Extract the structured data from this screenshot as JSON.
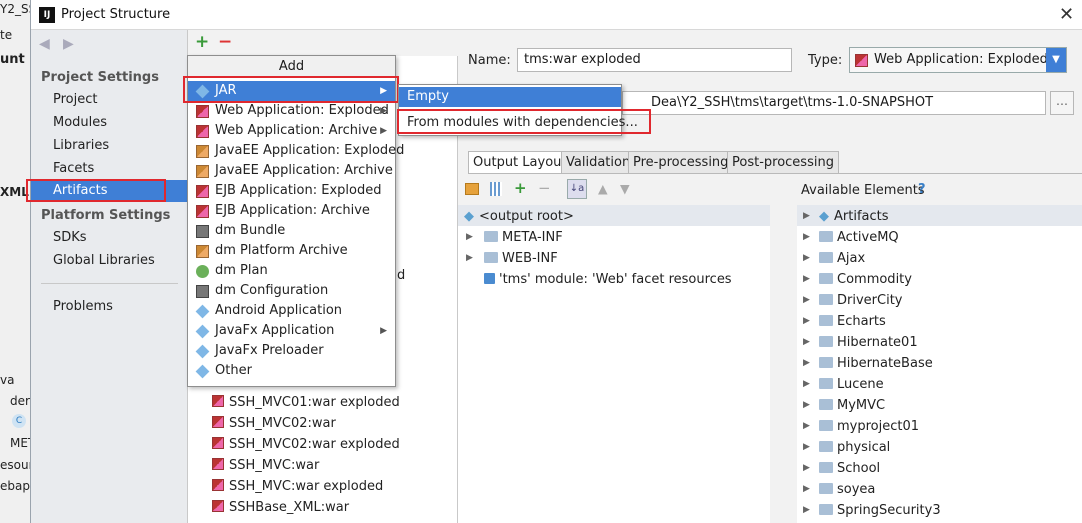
{
  "background_window": {
    "lines": [
      "Y2_SSH",
      "te",
      "C",
      "unt",
      "XML",
      "va",
      "der",
      "C",
      "MET",
      "esour",
      "ebap"
    ]
  },
  "window": {
    "title": "Project Structure",
    "close_glyph": "✕"
  },
  "left_nav": {
    "back": "◀",
    "forward": "▶",
    "project_settings_header": "Project Settings",
    "project_settings": [
      "Project",
      "Modules",
      "Libraries",
      "Facets",
      "Artifacts"
    ],
    "platform_settings_header": "Platform Settings",
    "platform_settings": [
      "SDKs",
      "Global Libraries"
    ],
    "problems": "Problems"
  },
  "artifacts_toolbar": {
    "add": "+",
    "remove": "−"
  },
  "artifacts_list": [
    {
      "name": "d",
      "partial": true
    },
    {
      "name": "SSH_MVC01:war exploded"
    },
    {
      "name": "SSH_MVC02:war"
    },
    {
      "name": "SSH_MVC02:war exploded"
    },
    {
      "name": "SSH_MVC:war"
    },
    {
      "name": "SSH_MVC:war exploded"
    },
    {
      "name": "SSHBase_XML:war"
    }
  ],
  "add_menu": {
    "header": "Add",
    "items": [
      {
        "label": "JAR",
        "icon": "jar-icon",
        "submenu": true,
        "highlighted": true
      },
      {
        "label": "Web Application: Exploded",
        "icon": "web-app-icon",
        "submenu": true
      },
      {
        "label": "Web Application: Archive",
        "icon": "web-app-icon",
        "submenu": true
      },
      {
        "label": "JavaEE Application: Exploded",
        "icon": "javaee-icon"
      },
      {
        "label": "JavaEE Application: Archive",
        "icon": "javaee-icon"
      },
      {
        "label": "EJB Application: Exploded",
        "icon": "ejb-icon"
      },
      {
        "label": "EJB Application: Archive",
        "icon": "ejb-icon"
      },
      {
        "label": "dm Bundle",
        "icon": "dm-bundle-icon"
      },
      {
        "label": "dm Platform Archive",
        "icon": "dm-platform-icon"
      },
      {
        "label": "dm Plan",
        "icon": "dm-plan-icon"
      },
      {
        "label": "dm Configuration",
        "icon": "dm-config-icon"
      },
      {
        "label": "Android Application",
        "icon": "android-icon"
      },
      {
        "label": "JavaFx Application",
        "icon": "javafx-icon",
        "submenu": true
      },
      {
        "label": "JavaFx Preloader",
        "icon": "javafx-icon"
      },
      {
        "label": "Other",
        "icon": "other-icon"
      }
    ],
    "submenu_glyph": "▶"
  },
  "jar_submenu": {
    "items": [
      "Empty",
      "From modules with dependencies..."
    ]
  },
  "detail": {
    "name_label": "Name:",
    "name_value": "tms:war exploded",
    "type_label": "Type:",
    "type_value": "Web Application: Exploded",
    "output_path": "Dea\\Y2_SSH\\tms\\target\\tms-1.0-SNAPSHOT",
    "browse": "...",
    "tabs": [
      "Output Layout",
      "Validation",
      "Pre-processing",
      "Post-processing"
    ],
    "active_tab": "Output Layout",
    "available_header": "Available Elements",
    "help": "?"
  },
  "output_tree": [
    {
      "label": "<output root>",
      "type": "root"
    },
    {
      "label": "META-INF",
      "type": "folder",
      "expandable": true
    },
    {
      "label": "WEB-INF",
      "type": "folder",
      "expandable": true
    },
    {
      "label": "'tms' module: 'Web' facet resources",
      "type": "facet"
    }
  ],
  "available_tree": [
    "Artifacts",
    "ActiveMQ",
    "Ajax",
    "Commodity",
    "DriverCity",
    "Echarts",
    "Hibernate01",
    "HibernateBase",
    "Lucene",
    "MyMVC",
    "myproject01",
    "physical",
    "School",
    "soyea",
    "SpringSecurity3"
  ],
  "colors": {
    "selection": "#3f7fd6",
    "highlight_border": "#e0282e"
  }
}
